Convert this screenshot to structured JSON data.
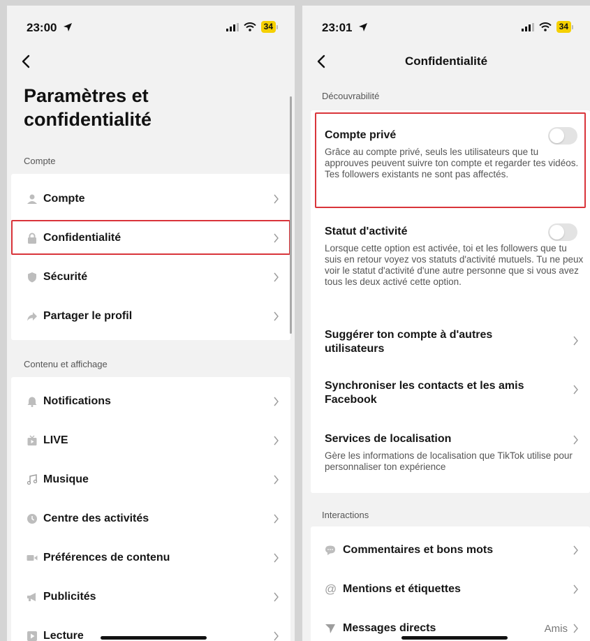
{
  "left": {
    "status": {
      "time": "23:00",
      "battery": "34"
    },
    "title": "Paramètres et confidentialité",
    "section_compte": "Compte",
    "compte_items": [
      {
        "label": "Compte",
        "icon": "person-icon"
      },
      {
        "label": "Confidentialité",
        "icon": "lock-icon"
      },
      {
        "label": "Sécurité",
        "icon": "shield-icon"
      },
      {
        "label": "Partager le profil",
        "icon": "share-icon"
      }
    ],
    "section_contenu": "Contenu et affichage",
    "contenu_items": [
      {
        "label": "Notifications",
        "icon": "bell-icon"
      },
      {
        "label": "LIVE",
        "icon": "live-tv-icon"
      },
      {
        "label": "Musique",
        "icon": "music-note-icon"
      },
      {
        "label": "Centre des activités",
        "icon": "clock-icon"
      },
      {
        "label": "Préférences de contenu",
        "icon": "video-camera-icon"
      },
      {
        "label": "Publicités",
        "icon": "megaphone-icon"
      },
      {
        "label": "Lecture",
        "icon": "play-icon"
      }
    ]
  },
  "right": {
    "status": {
      "time": "23:01",
      "battery": "34"
    },
    "nav_title": "Confidentialité",
    "section_decouvrabilite": "Découvrabilité",
    "compte_prive": {
      "title": "Compte privé",
      "description": "Grâce au compte privé, seuls les utilisateurs que tu approuves peuvent suivre ton compte et regarder tes vidéos. Tes followers existants ne sont pas affectés."
    },
    "statut_activite": {
      "title": "Statut d'activité",
      "description": "Lorsque cette option est activée, toi et les followers que tu suis en retour voyez vos statuts d'activité mutuels. Tu ne peux voir le statut d'activité d'une autre personne que si vous avez tous les deux activé cette option."
    },
    "suggerer": {
      "title": "Suggérer ton compte à d'autres utilisateurs"
    },
    "synchroniser": {
      "title": "Synchroniser les contacts et les amis Facebook"
    },
    "localisation": {
      "title": "Services de localisation",
      "description": "Gère les informations de localisation que TikTok utilise pour personnaliser ton expérience"
    },
    "section_interactions": "Interactions",
    "interactions": [
      {
        "label": "Commentaires et bons mots",
        "icon": "comment-icon",
        "value": ""
      },
      {
        "label": "Mentions et étiquettes",
        "icon": "at-icon",
        "value": ""
      },
      {
        "label": "Messages directs",
        "icon": "send-icon",
        "value": "Amis"
      }
    ]
  },
  "colors": {
    "highlight": "#d9343a",
    "battery": "#f5d000",
    "toggle_off": "#e3e3e3"
  }
}
